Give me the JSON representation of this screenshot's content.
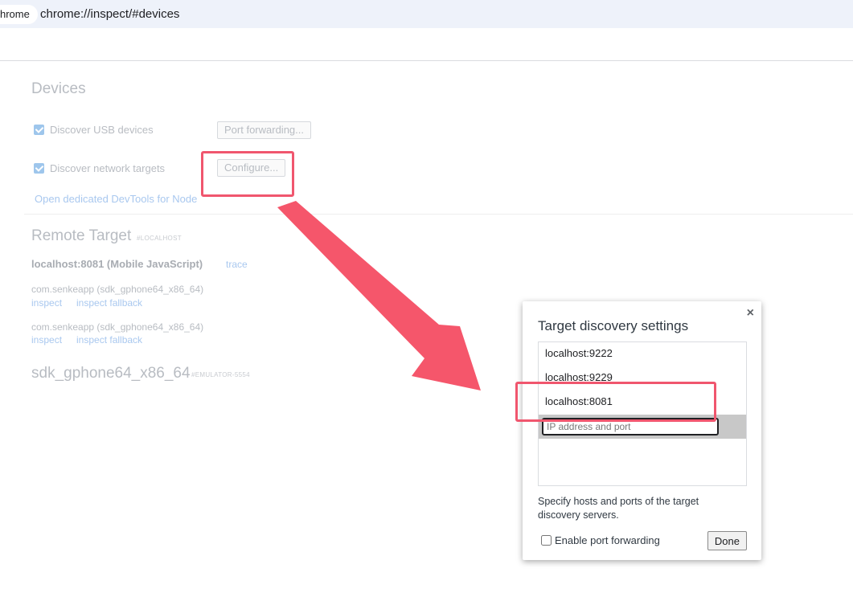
{
  "browser": {
    "chip_label": "hrome",
    "url_prefix": "chrome://",
    "url_host": "inspect",
    "url_suffix": "/#devices"
  },
  "devices": {
    "heading": "Devices",
    "discover_usb_label": "Discover USB devices",
    "discover_usb_checked": true,
    "port_forwarding_button": "Port forwarding...",
    "discover_network_label": "Discover network targets",
    "discover_network_checked": true,
    "configure_button": "Configure...",
    "open_node_link": "Open dedicated DevTools for Node"
  },
  "remote_target": {
    "heading": "Remote Target",
    "tag": "#LOCALHOST",
    "target_name": "localhost:8081 (Mobile JavaScript)",
    "trace_link": "trace",
    "entries": [
      {
        "label": "com.senkeapp (sdk_gphone64_x86_64)",
        "inspect": "inspect",
        "fallback": "inspect fallback"
      },
      {
        "label": "com.senkeapp (sdk_gphone64_x86_64)",
        "inspect": "inspect",
        "fallback": "inspect fallback"
      }
    ],
    "device_heading": "sdk_gphone64_x86_64",
    "device_tag": "#EMULATOR-5554"
  },
  "dialog": {
    "title": "Target discovery settings",
    "close_symbol": "×",
    "targets": [
      "localhost:9222",
      "localhost:9229",
      "localhost:8081"
    ],
    "input_placeholder": "IP address and port",
    "description": "Specify hosts and ports of the target discovery servers.",
    "enable_port_forwarding_label": "Enable port forwarding",
    "enable_port_forwarding_checked": false,
    "done_button": "Done"
  },
  "annotations": {
    "highlight_color": "#f0566e",
    "arrow_color": "#f5566b"
  }
}
